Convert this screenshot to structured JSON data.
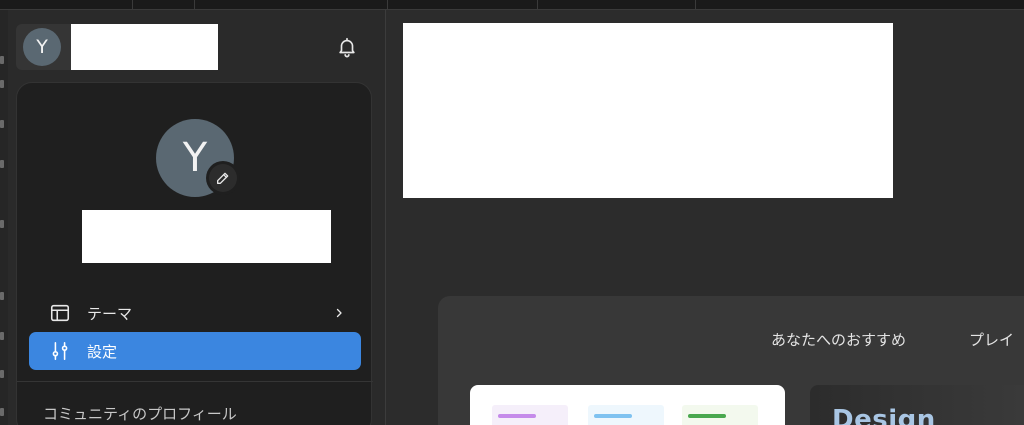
{
  "sidebar": {
    "user_initial": "Y",
    "bell_icon": "bell-icon"
  },
  "profile_popup": {
    "avatar_initial": "Y",
    "edit_icon": "pencil-icon",
    "menu": [
      {
        "label": "テーマ",
        "icon": "layout-icon",
        "has_submenu": true,
        "active": false
      },
      {
        "label": "設定",
        "icon": "sliders-icon",
        "has_submenu": false,
        "active": true
      }
    ],
    "community_label": "コミュニティのプロフィール"
  },
  "recommendations": {
    "tabs": [
      "あなたへのおすすめ",
      "プレイ"
    ],
    "design_card_title": "Design"
  },
  "colors": {
    "accent": "#3b86e0",
    "avatar_bg": "#5a6872",
    "popup_bg": "#1f1f1f"
  }
}
